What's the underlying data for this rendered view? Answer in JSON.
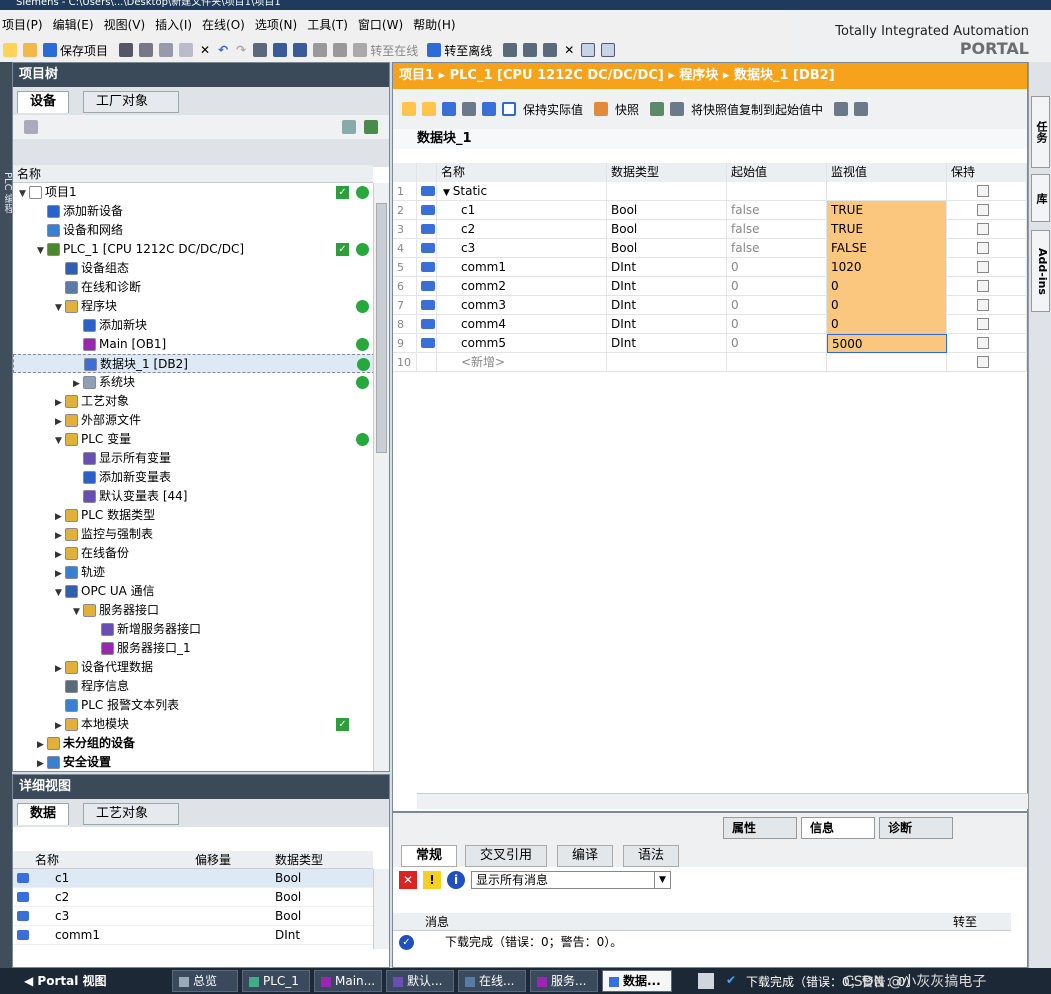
{
  "title_bar": "Siemens  -  C:\\Users\\...\\Desktop\\新建文件夹\\项目1\\项目1",
  "menu": [
    "项目(P)",
    "编辑(E)",
    "视图(V)",
    "插入(I)",
    "在线(O)",
    "选项(N)",
    "工具(T)",
    "窗口(W)",
    "帮助(H)"
  ],
  "toolbar": {
    "save": "保存项目",
    "go_online": "转至在线",
    "go_offline": "转至离线"
  },
  "brand": {
    "line1": "Totally Integrated Automation",
    "line2": "PORTAL"
  },
  "left_strip_label": "PLC 编程",
  "project_tree": {
    "title": "项目树",
    "tabs": [
      "设备",
      "工厂对象"
    ],
    "col_name": "名称",
    "items": [
      {
        "label": "项目1",
        "indent": 0,
        "arrow": "▼",
        "color": "#ffffff",
        "ok": true,
        "dot": true
      },
      {
        "label": "添加新设备",
        "indent": 1,
        "arrow": "",
        "color": "#2a62c9"
      },
      {
        "label": "设备和网络",
        "indent": 1,
        "arrow": "",
        "color": "#3b7fd1"
      },
      {
        "label": "PLC_1 [CPU 1212C DC/DC/DC]",
        "indent": 1,
        "arrow": "▼",
        "color": "#4a8a2c",
        "ok": true,
        "dot": true
      },
      {
        "label": "设备组态",
        "indent": 2,
        "arrow": "",
        "color": "#2f5fb3"
      },
      {
        "label": "在线和诊断",
        "indent": 2,
        "arrow": "",
        "color": "#5a7aa8"
      },
      {
        "label": "程序块",
        "indent": 2,
        "arrow": "▼",
        "color": "#e2b13c",
        "dot": true
      },
      {
        "label": "添加新块",
        "indent": 3,
        "arrow": "",
        "color": "#2a62c9"
      },
      {
        "label": "Main [OB1]",
        "indent": 3,
        "arrow": "",
        "color": "#9b27b0",
        "dot": true
      },
      {
        "label": "数据块_1 [DB2]",
        "indent": 3,
        "arrow": "",
        "color": "#3b6fd8",
        "dot": true,
        "selected": true
      },
      {
        "label": "系统块",
        "indent": 3,
        "arrow": "▶",
        "color": "#8fa0b5",
        "dot": true
      },
      {
        "label": "工艺对象",
        "indent": 2,
        "arrow": "▶",
        "color": "#e2b13c"
      },
      {
        "label": "外部源文件",
        "indent": 2,
        "arrow": "▶",
        "color": "#e2b13c"
      },
      {
        "label": "PLC 变量",
        "indent": 2,
        "arrow": "▼",
        "color": "#e2b13c",
        "dot": true
      },
      {
        "label": "显示所有变量",
        "indent": 3,
        "arrow": "",
        "color": "#6a4fb3"
      },
      {
        "label": "添加新变量表",
        "indent": 3,
        "arrow": "",
        "color": "#2a62c9"
      },
      {
        "label": "默认变量表 [44]",
        "indent": 3,
        "arrow": "",
        "color": "#6a4fb3"
      },
      {
        "label": "PLC 数据类型",
        "indent": 2,
        "arrow": "▶",
        "color": "#e2b13c"
      },
      {
        "label": "监控与强制表",
        "indent": 2,
        "arrow": "▶",
        "color": "#e2b13c"
      },
      {
        "label": "在线备份",
        "indent": 2,
        "arrow": "▶",
        "color": "#e2b13c"
      },
      {
        "label": "轨迹",
        "indent": 2,
        "arrow": "▶",
        "color": "#3b7fd1"
      },
      {
        "label": "OPC UA 通信",
        "indent": 2,
        "arrow": "▼",
        "color": "#2f5fb3"
      },
      {
        "label": "服务器接口",
        "indent": 3,
        "arrow": "▼",
        "color": "#e2b13c"
      },
      {
        "label": "新增服务器接口",
        "indent": 4,
        "arrow": "",
        "color": "#6a4fb3"
      },
      {
        "label": "服务器接口_1",
        "indent": 4,
        "arrow": "",
        "color": "#9b27b0"
      },
      {
        "label": "设备代理数据",
        "indent": 2,
        "arrow": "▶",
        "color": "#e2b13c"
      },
      {
        "label": "程序信息",
        "indent": 2,
        "arrow": "",
        "color": "#5a6a7a"
      },
      {
        "label": "PLC 报警文本列表",
        "indent": 2,
        "arrow": "",
        "color": "#3b7fd1"
      },
      {
        "label": "本地模块",
        "indent": 2,
        "arrow": "▶",
        "color": "#e2b13c",
        "ok": true
      },
      {
        "label": "未分组的设备",
        "indent": 1,
        "arrow": "▶",
        "color": "#e2b13c"
      },
      {
        "label": "安全设置",
        "indent": 1,
        "arrow": "▶",
        "color": "#3b7fd1"
      }
    ]
  },
  "detail_view": {
    "title": "详细视图",
    "tabs": [
      "数据",
      "工艺对象"
    ],
    "columns": [
      "名称",
      "偏移量",
      "数据类型"
    ],
    "rows": [
      {
        "name": "c1",
        "offset": "",
        "type": "Bool"
      },
      {
        "name": "c2",
        "offset": "",
        "type": "Bool"
      },
      {
        "name": "c3",
        "offset": "",
        "type": "Bool"
      },
      {
        "name": "comm1",
        "offset": "",
        "type": "DInt"
      }
    ]
  },
  "editor": {
    "breadcrumb": "项目1  ▸  PLC_1 [CPU 1212C DC/DC/DC]  ▸  程序块  ▸  数据块_1 [DB2]",
    "toolbar": {
      "keep": "保持实际值",
      "snapshot": "快照",
      "copy": "将快照值复制到起始值中"
    },
    "block_title": "数据块_1",
    "columns": [
      "名称",
      "数据类型",
      "起始值",
      "监视值",
      "保持"
    ],
    "rows": [
      {
        "n": "1",
        "name": "Static",
        "type": "",
        "start": "",
        "monitor": ""
      },
      {
        "n": "2",
        "name": "c1",
        "type": "Bool",
        "start": "false",
        "monitor": "TRUE"
      },
      {
        "n": "3",
        "name": "c2",
        "type": "Bool",
        "start": "false",
        "monitor": "TRUE"
      },
      {
        "n": "4",
        "name": "c3",
        "type": "Bool",
        "start": "false",
        "monitor": "FALSE"
      },
      {
        "n": "5",
        "name": "comm1",
        "type": "DInt",
        "start": "0",
        "monitor": "1020"
      },
      {
        "n": "6",
        "name": "comm2",
        "type": "DInt",
        "start": "0",
        "monitor": "0"
      },
      {
        "n": "7",
        "name": "comm3",
        "type": "DInt",
        "start": "0",
        "monitor": "0"
      },
      {
        "n": "8",
        "name": "comm4",
        "type": "DInt",
        "start": "0",
        "monitor": "0"
      },
      {
        "n": "9",
        "name": "comm5",
        "type": "DInt",
        "start": "0",
        "monitor": "5000"
      },
      {
        "n": "10",
        "name": "<新增>",
        "type": "",
        "start": "",
        "monitor": ""
      }
    ]
  },
  "inspector": {
    "tabs": [
      "属性",
      "信息",
      "诊断"
    ],
    "subtabs": [
      "常规",
      "交叉引用",
      "编译",
      "语法"
    ],
    "filter": "显示所有消息",
    "col_msg": "消息",
    "col_goto": "转至",
    "message": "下载完成（错误：0；警告：0）。"
  },
  "right_tabs": [
    "任务",
    "库",
    "Add-ins"
  ],
  "taskbar": {
    "portal": "Portal 视图",
    "items": [
      "总览",
      "PLC_1",
      "Main...",
      "默认...",
      "在线...",
      "服务...",
      "数据..."
    ],
    "status": "下载完成（错误：0；警告：0）",
    "watermark": "CSDN @小灰灰搞电子"
  }
}
